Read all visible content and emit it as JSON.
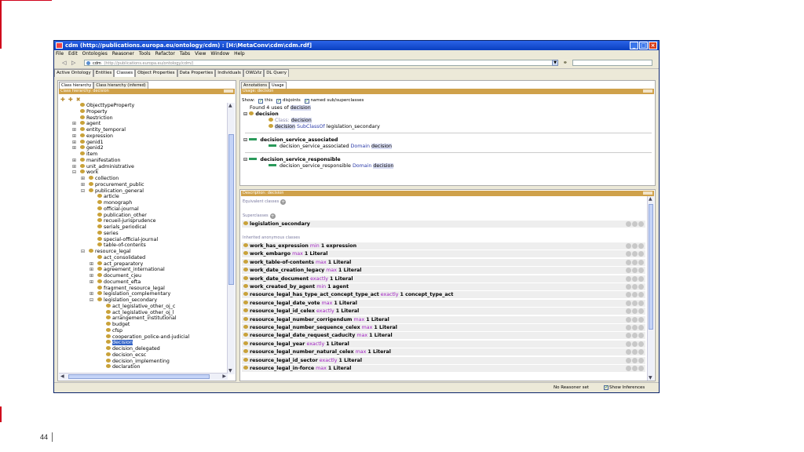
{
  "window": {
    "title": "cdm (http://publications.europa.eu/ontology/cdm) : [H:\\MetaConv\\cdm\\cdm.rdf]",
    "menus": [
      "File",
      "Edit",
      "Ontologies",
      "Reasoner",
      "Tools",
      "Refactor",
      "Tabs",
      "View",
      "Window",
      "Help"
    ],
    "address": {
      "name": "cdm",
      "url": "(http://publications.europa.eu/ontology/cdm/)"
    },
    "tabs": [
      "Active Ontology",
      "Entities",
      "Classes",
      "Object Properties",
      "Data Properties",
      "Individuals",
      "OWLViz",
      "DL Query"
    ],
    "selected_tab": "Classes"
  },
  "left": {
    "tabs": [
      "Class hierarchy",
      "Class hierarchy (inferred)"
    ],
    "header": "Class hierarchy: decision",
    "tree": [
      "ObjecttypeProperty",
      "Property",
      "Restriction",
      "agent",
      "entity_temporal",
      "expression",
      "genid1",
      "genid2",
      "item",
      "manifestation",
      "unit_administrative",
      "work",
      "collection",
      "procurement_public",
      "publication_general",
      "article",
      "monograph",
      "official-journal",
      "publication_other",
      "recueil-jurisprudence",
      "serials_periodical",
      "series",
      "special-official-journal",
      "table-of-contents",
      "resource_legal",
      "act_consolidated",
      "act_preparatory",
      "agreement_international",
      "document_cjeu",
      "document_efta",
      "fragment_resource_legal",
      "legislation_complementary",
      "legislation_secondary",
      "act_legislative_other_oj_c",
      "act_legislative_other_oj_l",
      "arrangement_institutional",
      "budget",
      "cfsp",
      "cooperation_police-and-judicial",
      "decision",
      "decision_delegated",
      "decision_ecsc",
      "decision_implementing",
      "declaration"
    ]
  },
  "usage": {
    "tabs": [
      "Annotations",
      "Usage"
    ],
    "header": "Usage: decision",
    "show_label": "Show:",
    "options": [
      "this",
      "disjoints",
      "named sub/superclasses"
    ],
    "found_prefix": "Found 4 uses of",
    "found_term": "decision",
    "root": "decision",
    "class_kw": "Class:",
    "class_val": "decision",
    "subclass_left": "decision",
    "subclass_kw": "SubClassOf",
    "subclass_right": "legislation_secondary",
    "prop1": "decision_service_associated",
    "prop1_axiom_left": "decision_service_associated",
    "domain_kw": "Domain",
    "domain_val": "decision",
    "prop2": "decision_service_responsible",
    "prop2_axiom_left": "decision_service_responsible"
  },
  "description": {
    "header": "Description: decision",
    "equivalent": "Equivalent classes",
    "superclasses": "Superclasses",
    "superclass_value": "legislation_secondary",
    "inherited": "Inherited anonymous classes",
    "rows": [
      {
        "pre": "work_has_expression",
        "kw": "min",
        "post": "1 expression"
      },
      {
        "pre": "work_embargo",
        "kw": "max",
        "post": "1 Literal"
      },
      {
        "pre": "work_table-of-contents",
        "kw": "max",
        "post": "1 Literal"
      },
      {
        "pre": "work_date_creation_legacy",
        "kw": "max",
        "post": "1 Literal"
      },
      {
        "pre": "work_date_document",
        "kw": "exactly",
        "post": "1 Literal"
      },
      {
        "pre": "work_created_by_agent",
        "kw": "min",
        "post": "1 agent"
      },
      {
        "pre": "resource_legal_has_type_act_concept_type_act",
        "kw": "exactly",
        "post": "1 concept_type_act"
      },
      {
        "pre": "resource_legal_date_vote",
        "kw": "max",
        "post": "1 Literal"
      },
      {
        "pre": "resource_legal_id_celex",
        "kw": "exactly",
        "post": "1 Literal"
      },
      {
        "pre": "resource_legal_number_corrigendum",
        "kw": "max",
        "post": "1 Literal"
      },
      {
        "pre": "resource_legal_number_sequence_celex",
        "kw": "max",
        "post": "1 Literal"
      },
      {
        "pre": "resource_legal_date_request_caducity",
        "kw": "max",
        "post": "1 Literal"
      },
      {
        "pre": "resource_legal_year",
        "kw": "exactly",
        "post": "1 Literal"
      },
      {
        "pre": "resource_legal_number_natural_celex",
        "kw": "max",
        "post": "1 Literal"
      },
      {
        "pre": "resource_legal_id_sector",
        "kw": "exactly",
        "post": "1 Literal"
      },
      {
        "pre": "resource_legal_in-force",
        "kw": "max",
        "post": "1 Literal"
      }
    ]
  },
  "status": {
    "reasoner": "No Reasoner set",
    "show_inferences": "Show Inferences"
  },
  "slide": {
    "page_number": "44"
  },
  "colors": {
    "accent": "#d0021b",
    "panel_header": "#cfa14a",
    "class_dot": "#c9a23a",
    "selection": "#3162c6",
    "keyword": "#a020c0"
  }
}
